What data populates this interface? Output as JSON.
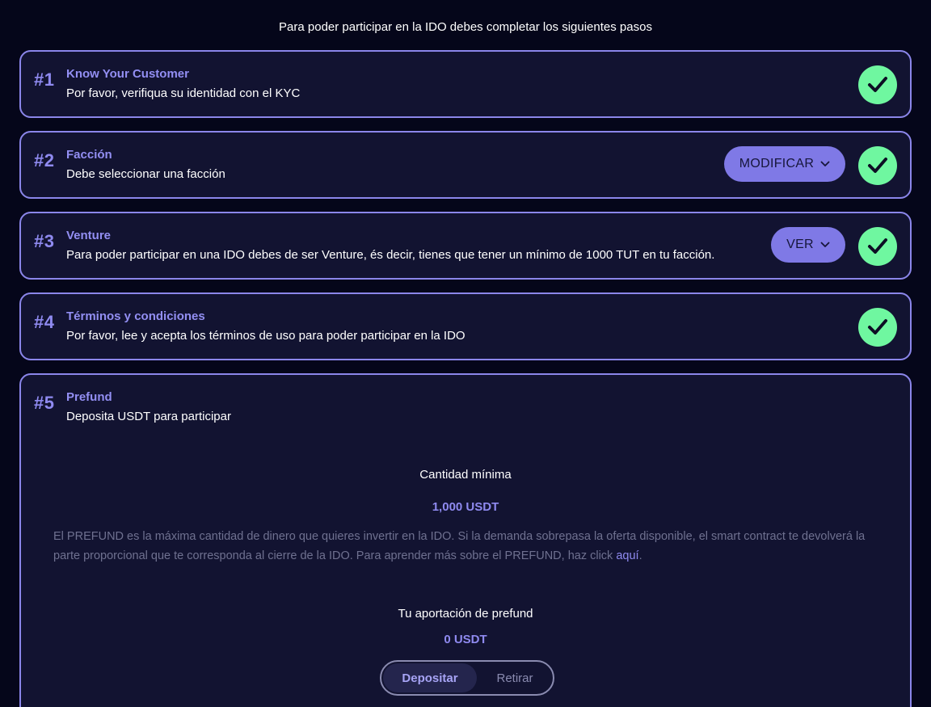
{
  "intro": "Para poder participar en la IDO debes completar los siguientes pasos",
  "steps": [
    {
      "num": "#1",
      "title": "Know Your Customer",
      "desc": "Por favor, verifiqua su identidad con el KYC"
    },
    {
      "num": "#2",
      "title": "Facción",
      "desc": "Debe seleccionar una facción",
      "button": "MODIFICAR"
    },
    {
      "num": "#3",
      "title": "Venture",
      "desc": "Para poder participar en una IDO debes de ser Venture, és decir, tienes que tener un mínimo de 1000 TUT en tu facción.",
      "button": "VER"
    },
    {
      "num": "#4",
      "title": "Términos y condiciones",
      "desc": "Por favor, lee y acepta los términos de uso para poder participar en la IDO"
    }
  ],
  "prefund": {
    "num": "#5",
    "title": "Prefund",
    "desc": "Deposita USDT para participar",
    "min_label": "Cantidad mínima",
    "min_value": "1,000  USDT",
    "info_text": "El PREFUND es la máxima cantidad de dinero que quieres invertir en la IDO. Si la demanda sobrepasa la oferta disponible, el smart contract te devolverá la parte proporcional que te corresponda al cierre de la IDO. Para aprender más sobre el PREFUND, haz click ",
    "info_link": "aquí",
    "info_end": ".",
    "contrib_label": "Tu aportación de prefund",
    "contrib_value": "0  USDT",
    "toggle": {
      "deposit": "Depositar",
      "withdraw": "Retirar"
    }
  },
  "colors": {
    "accent": "#8f8af0",
    "check": "#6ff7a0",
    "background": "#05061a",
    "card": "#121331"
  }
}
